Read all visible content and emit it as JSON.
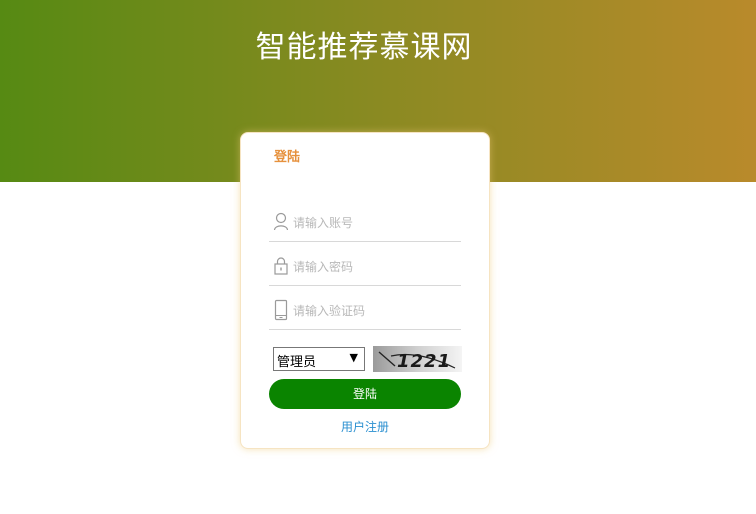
{
  "site": {
    "title": "智能推荐慕课网"
  },
  "login_card": {
    "title": "登陆",
    "username": {
      "placeholder": "请输入账号",
      "icon": "user-icon"
    },
    "password": {
      "placeholder": "请输入密码",
      "icon": "lock-icon"
    },
    "captcha_input": {
      "placeholder": "请输入验证码",
      "icon": "phone-icon"
    },
    "role": {
      "selected": "管理员"
    },
    "captcha_image": {
      "text": "1221"
    },
    "submit_label": "登陆",
    "register_label": "用户注册"
  },
  "colors": {
    "hero_left": "#568a13",
    "hero_right": "#b98a2b",
    "title_accent": "#e6913d",
    "button": "#0a8400",
    "link": "#2a8fd0"
  }
}
